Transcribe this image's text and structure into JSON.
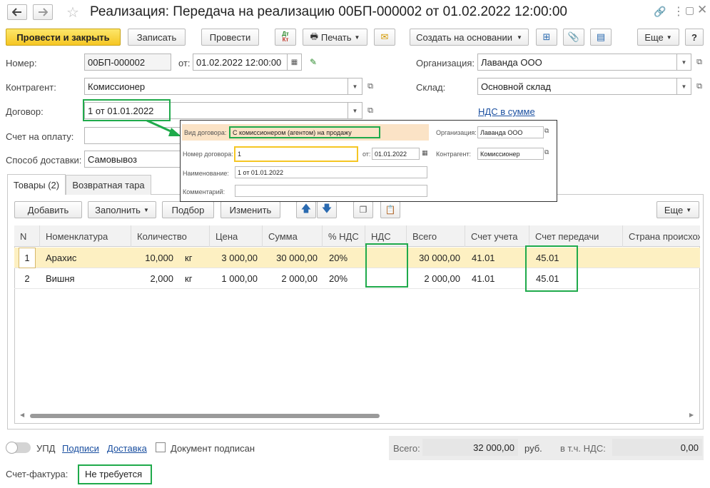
{
  "window": {
    "title": "Реализация: Передача на реализацию 00БП-000002 от 01.02.2022 12:00:00"
  },
  "toolbar": {
    "post_close": "Провести и закрыть",
    "save": "Записать",
    "post": "Провести",
    "dtkt_top": "Дт",
    "dtkt_bottom": "Кт",
    "print": "Печать",
    "create_based": "Создать на основании",
    "more": "Еще",
    "help": "?"
  },
  "form": {
    "number_label": "Номер:",
    "number_value": "00БП-000002",
    "date_label": "от:",
    "date_value": "01.02.2022 12:00:00",
    "org_label": "Организация:",
    "org_value": "Лаванда ООО",
    "counterparty_label": "Контрагент:",
    "counterparty_value": "Комиссионер",
    "warehouse_label": "Склад:",
    "warehouse_value": "Основной склад",
    "contract_label": "Договор:",
    "contract_value": "1 от 01.01.2022",
    "vat_link": "НДС в сумме",
    "invoice_label": "Счет на оплату:",
    "invoice_value": "",
    "delivery_label": "Способ доставки:",
    "delivery_value": "Самовывоз"
  },
  "popup": {
    "contract_type_label": "Вид договора:",
    "contract_type_value": "С комиссионером (агентом) на продажу",
    "org_label": "Организация:",
    "org_value": "Лаванда ООО",
    "contract_no_label": "Номер договора:",
    "contract_no_value": "1",
    "date_label": "от:",
    "date_value": "01.01.2022",
    "counterparty_label": "Контрагент:",
    "counterparty_value": "Комиссионер",
    "name_label": "Наименование:",
    "name_value": "1 от 01.01.2022",
    "comment_label": "Комментарий:",
    "comment_value": ""
  },
  "tabs": [
    {
      "label": "Товары (2)"
    },
    {
      "label": "Возвратная тара"
    }
  ],
  "table_toolbar": {
    "add": "Добавить",
    "fill": "Заполнить",
    "select": "Подбор",
    "edit": "Изменить",
    "more": "Еще"
  },
  "table": {
    "headers": [
      "N",
      "Номенклатура",
      "Количество",
      "Цена",
      "Сумма",
      "% НДС",
      "НДС",
      "Всего",
      "Счет учета",
      "Счет передачи",
      "Страна происхож"
    ],
    "rows": [
      {
        "n": "1",
        "item": "Арахис",
        "qty": "10,000",
        "unit": "кг",
        "price": "3 000,00",
        "sum": "30 000,00",
        "vat_rate": "20%",
        "vat": "",
        "total": "30 000,00",
        "account": "41.01",
        "transfer_account": "45.01",
        "country": ""
      },
      {
        "n": "2",
        "item": "Вишня",
        "qty": "2,000",
        "unit": "кг",
        "price": "1 000,00",
        "sum": "2 000,00",
        "vat_rate": "20%",
        "vat": "",
        "total": "2 000,00",
        "account": "41.01",
        "transfer_account": "45.01",
        "country": ""
      }
    ]
  },
  "footer": {
    "upd": "УПД",
    "signatures": "Подписи",
    "delivery": "Доставка",
    "signed": "Документ подписан",
    "total_label": "Всего:",
    "total_value": "32 000,00",
    "currency": "руб.",
    "vat_incl_label": "в т.ч. НДС:",
    "vat_incl_value": "0,00",
    "sf_label": "Счет-фактура:",
    "sf_value": "Не требуется"
  },
  "colors": {
    "primary_button": "#f5c623",
    "highlight_green": "#1faa4b",
    "selected_row": "#fdf0c2",
    "link": "#1a4fa0"
  }
}
